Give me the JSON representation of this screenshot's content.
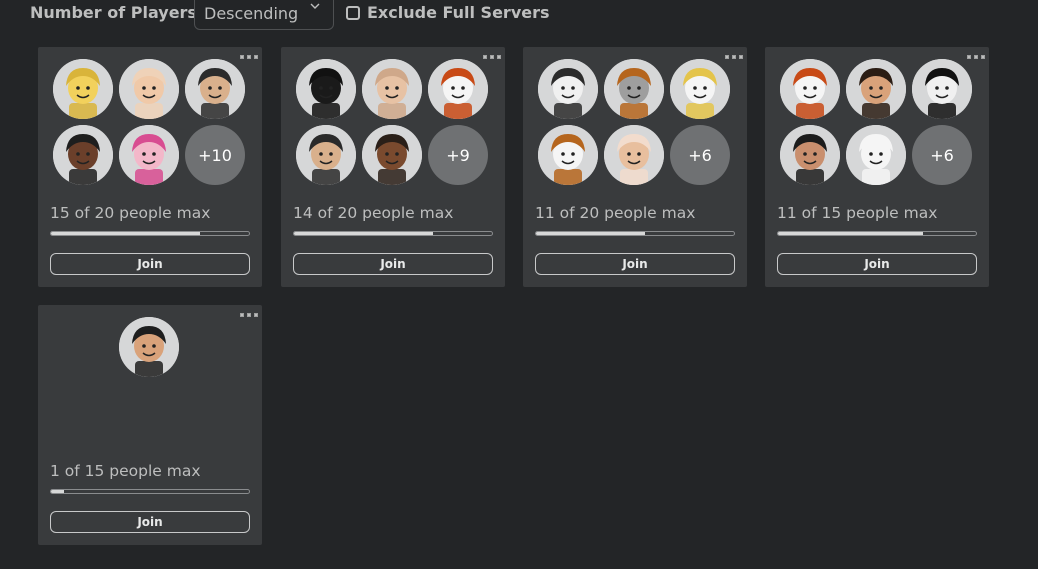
{
  "toolbar": {
    "sort_label": "Number of Players",
    "sort_value": "Descending",
    "exclude_label": "Exclude Full Servers",
    "exclude_checked": false
  },
  "servers": [
    {
      "status": "15 of 20 people max",
      "fill_fraction": 0.75,
      "join_label": "Join",
      "more_count": "+10",
      "avatars": [
        {
          "hair": "#d9b43a",
          "skin": "#f2d15c"
        },
        {
          "hair": "#efd2b8",
          "skin": "#f0c9a8"
        },
        {
          "hair": "#2b2b2b",
          "skin": "#d9b08c"
        },
        {
          "hair": "#1e1e1e",
          "skin": "#6b3f2a"
        },
        {
          "hair": "#d84c91",
          "skin": "#f3b7c9"
        }
      ]
    },
    {
      "status": "14 of 20 people max",
      "fill_fraction": 0.7,
      "join_label": "Join",
      "more_count": "+9",
      "avatars": [
        {
          "hair": "#111111",
          "skin": "#1a1a1a"
        },
        {
          "hair": "#cfa88a",
          "skin": "#e7c2a4"
        },
        {
          "hair": "#c84a16",
          "skin": "#f5f5f5"
        },
        {
          "hair": "#2a2a2a",
          "skin": "#d9b08c"
        },
        {
          "hair": "#2a1f18",
          "skin": "#7a4a2e"
        }
      ]
    },
    {
      "status": "11 of 20 people max",
      "fill_fraction": 0.55,
      "join_label": "Join",
      "more_count": "+6",
      "avatars": [
        {
          "hair": "#2b2b2b",
          "skin": "#f0f0f0"
        },
        {
          "hair": "#b5651d",
          "skin": "#9e9e9e"
        },
        {
          "hair": "#e4c44a",
          "skin": "#f5f5f5"
        },
        {
          "hair": "#b5651d",
          "skin": "#f5f5f5"
        },
        {
          "hair": "#f2dccd",
          "skin": "#e8bf9e"
        }
      ]
    },
    {
      "status": "11 of 15 people max",
      "fill_fraction": 0.733,
      "join_label": "Join",
      "more_count": "+6",
      "avatars": [
        {
          "hair": "#c84a16",
          "skin": "#f5f5f5"
        },
        {
          "hair": "#2b1d14",
          "skin": "#d9a27a"
        },
        {
          "hair": "#111111",
          "skin": "#f0f0f0"
        },
        {
          "hair": "#1c1c1c",
          "skin": "#c98f6e"
        },
        {
          "hair": "#f5f5f5",
          "skin": "#f5f5f5"
        }
      ]
    },
    {
      "status": "1 of 15 people max",
      "fill_fraction": 0.067,
      "join_label": "Join",
      "more_count": "",
      "avatars": [
        {
          "hair": "#1e1e1e",
          "skin": "#d9a27a"
        }
      ]
    }
  ]
}
